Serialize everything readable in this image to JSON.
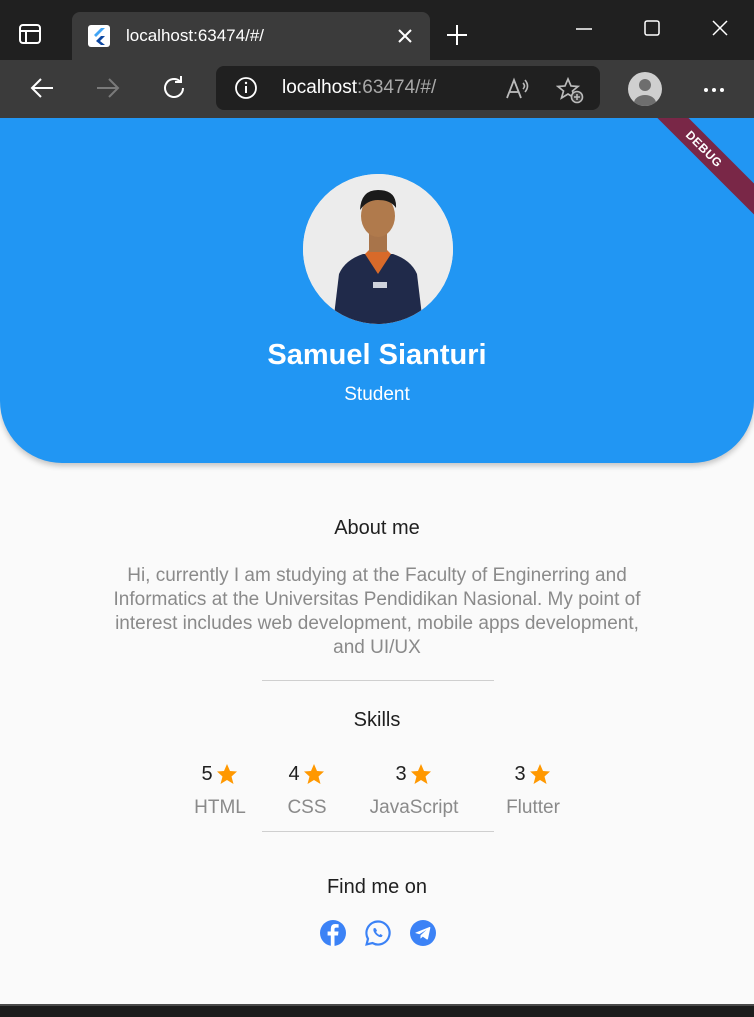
{
  "browser": {
    "tab_title": "localhost:63474/#/",
    "url_host": "localhost",
    "url_path": ":63474/#/"
  },
  "debug_banner": "DEBUG",
  "profile": {
    "name": "Samuel Sianturi",
    "role": "Student"
  },
  "about": {
    "title": "About me",
    "text": "Hi, currently I am studying at the Faculty of Enginerring and Informatics at the Universitas Pendidikan Nasional. My point of interest includes web development, mobile apps development, and UI/UX"
  },
  "skills": {
    "title": "Skills",
    "items": [
      {
        "rating": "5",
        "name": "HTML"
      },
      {
        "rating": "4",
        "name": "CSS"
      },
      {
        "rating": "3",
        "name": "JavaScript"
      },
      {
        "rating": "3",
        "name": "Flutter"
      }
    ]
  },
  "contact": {
    "title": "Find me on",
    "icons": [
      "facebook-icon",
      "whatsapp-icon",
      "telegram-icon"
    ]
  },
  "colors": {
    "header_blue": "#2196f3",
    "star_orange": "#ff9800",
    "social_blue": "#3b82f6"
  }
}
